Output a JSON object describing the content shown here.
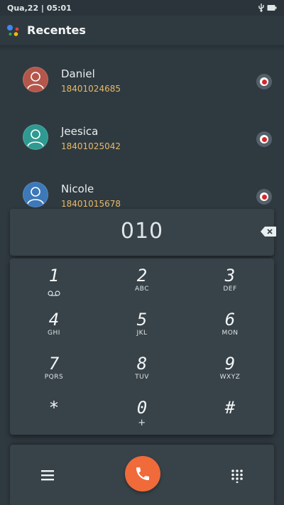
{
  "status": {
    "time": "Qua,22 | 05:01"
  },
  "appbar": {
    "title": "Recentes"
  },
  "contacts": [
    {
      "name": "Daniel",
      "number": "18401024685",
      "avatar_color": "#b4574a"
    },
    {
      "name": "Jeesica",
      "number": "18401025042",
      "avatar_color": "#2f9a91"
    },
    {
      "name": "Nicole",
      "number": "18401015678",
      "avatar_color": "#3d78b8"
    }
  ],
  "dialer": {
    "number": "010",
    "keys": [
      {
        "digit": "1",
        "letters": ""
      },
      {
        "digit": "2",
        "letters": "ABC"
      },
      {
        "digit": "3",
        "letters": "DEF"
      },
      {
        "digit": "4",
        "letters": "GHI"
      },
      {
        "digit": "5",
        "letters": "JKL"
      },
      {
        "digit": "6",
        "letters": "MON"
      },
      {
        "digit": "7",
        "letters": "PQRS"
      },
      {
        "digit": "8",
        "letters": "TUV"
      },
      {
        "digit": "9",
        "letters": "WXYZ"
      },
      {
        "digit": "*",
        "letters": ""
      },
      {
        "digit": "0",
        "letters": "+"
      },
      {
        "digit": "#",
        "letters": ""
      }
    ]
  },
  "colors": {
    "accent": "#f06a3a",
    "number": "#e7b96a",
    "background": "#2f3a40"
  }
}
